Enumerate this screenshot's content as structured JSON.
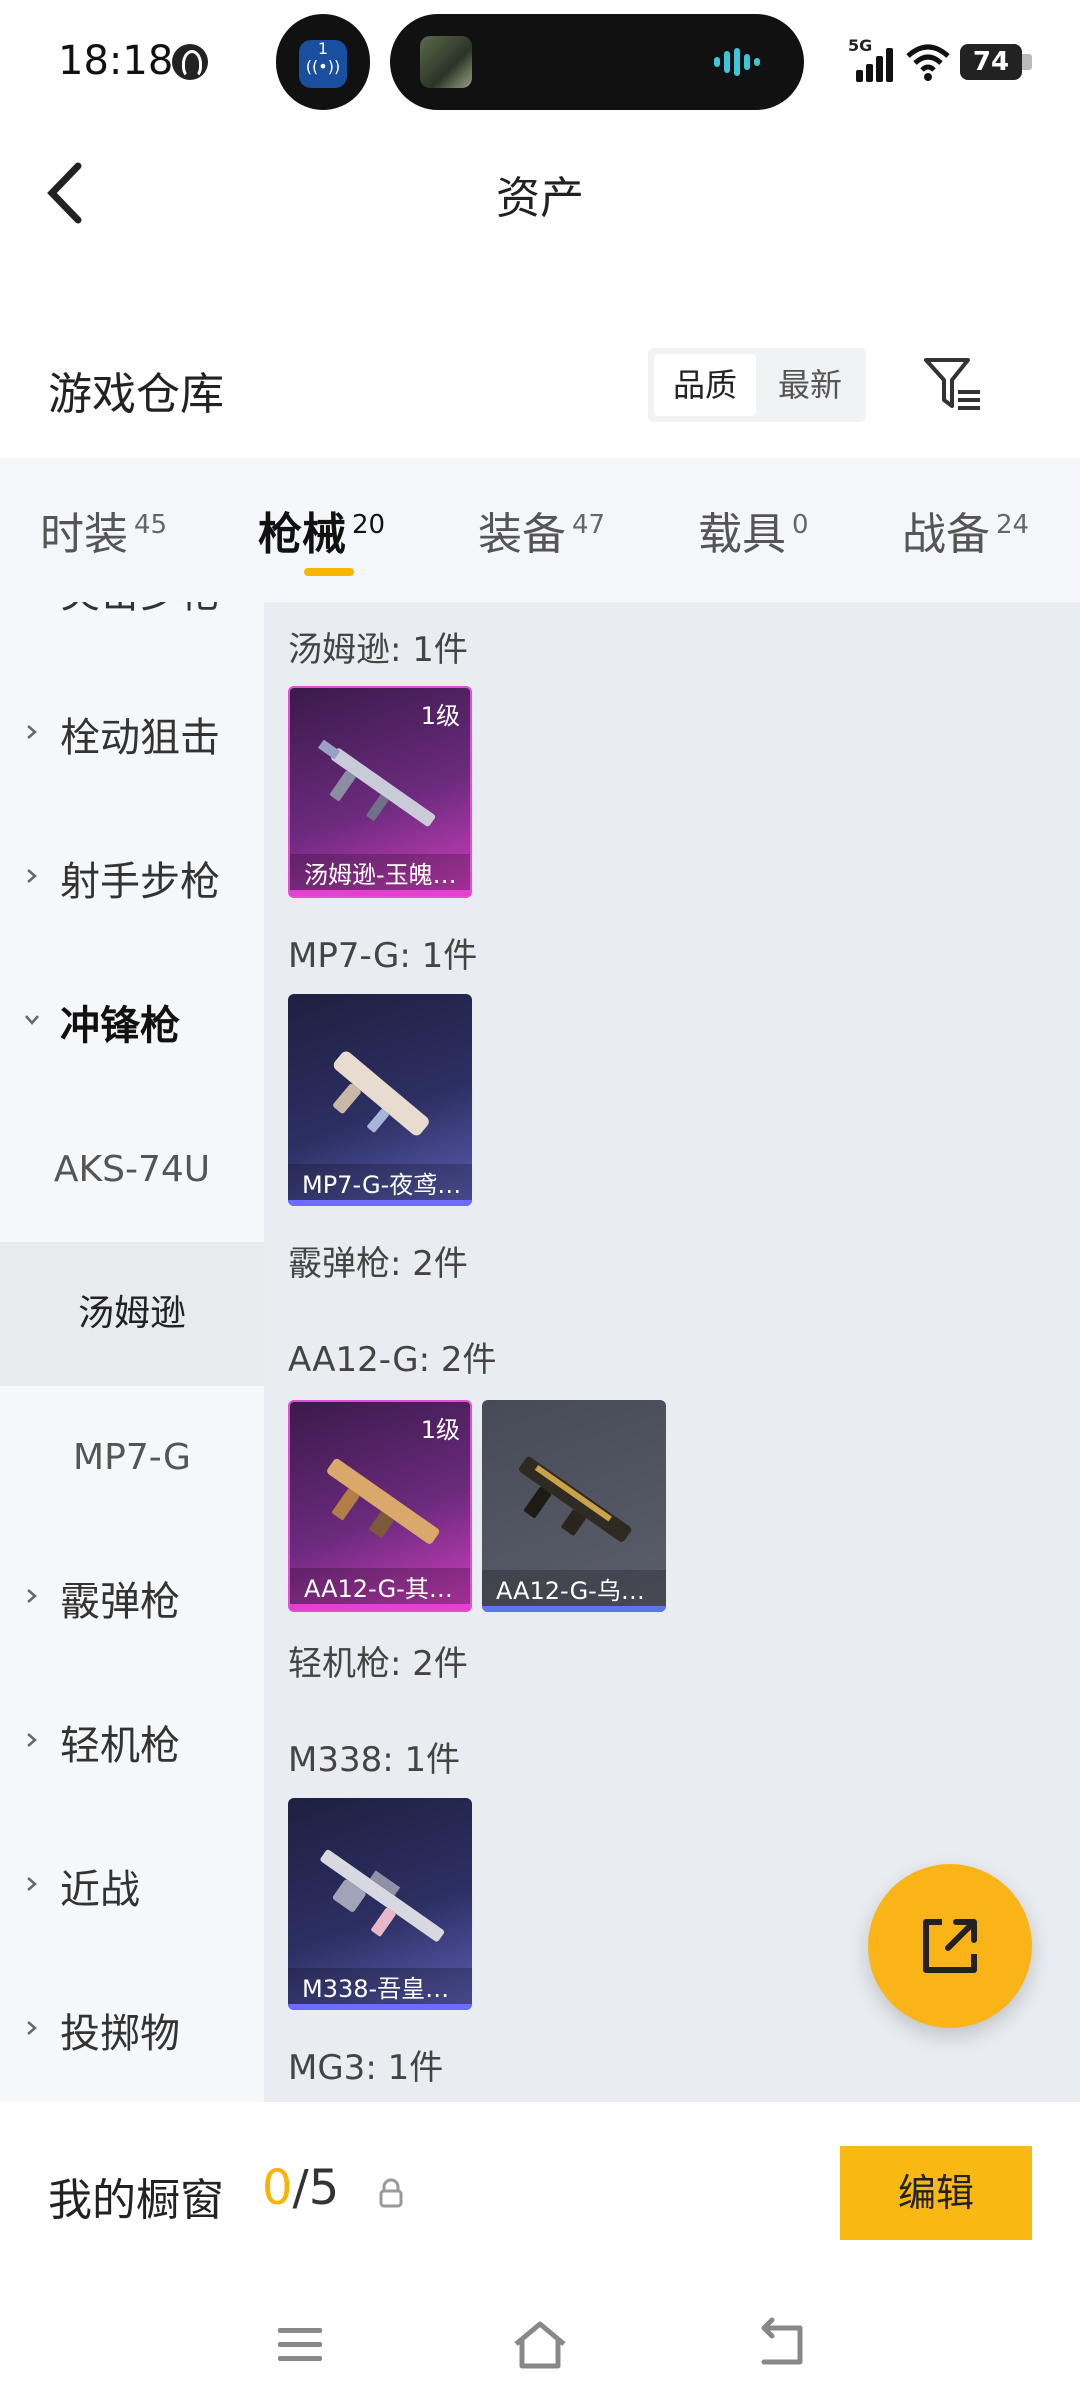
{
  "status_bar": {
    "time": "18:18",
    "network": "5G",
    "battery": "74",
    "notif_count": "1"
  },
  "header": {
    "title": "资产"
  },
  "warehouse": {
    "title": "游戏仓库",
    "sort_options": [
      {
        "label": "品质",
        "active": true
      },
      {
        "label": "最新",
        "active": false
      }
    ]
  },
  "tabs": [
    {
      "label": "时装",
      "count": "45",
      "active": false
    },
    {
      "label": "枪械",
      "count": "20",
      "active": true
    },
    {
      "label": "装备",
      "count": "47",
      "active": false
    },
    {
      "label": "载具",
      "count": "0",
      "active": false
    },
    {
      "label": "战备",
      "count": "24",
      "active": false
    }
  ],
  "sidebar": [
    {
      "label": "突击步枪",
      "type": "category"
    },
    {
      "label": "栓动狙击",
      "type": "category"
    },
    {
      "label": "射手步枪",
      "type": "category"
    },
    {
      "label": "冲锋枪",
      "type": "category-open"
    },
    {
      "label": "AKS-74U",
      "type": "sub"
    },
    {
      "label": "汤姆逊",
      "type": "sub-selected"
    },
    {
      "label": "MP7-G",
      "type": "sub"
    },
    {
      "label": "霰弹枪",
      "type": "category"
    },
    {
      "label": "轻机枪",
      "type": "category"
    },
    {
      "label": "近战",
      "type": "category"
    },
    {
      "label": "投掷物",
      "type": "category"
    }
  ],
  "content": {
    "groups": [
      {
        "label": "汤姆逊: 1件"
      },
      {
        "label": "MP7-G: 1件"
      },
      {
        "label": "霰弹枪: 2件"
      },
      {
        "label": "AA12-G: 2件"
      },
      {
        "label": "轻机枪: 2件"
      },
      {
        "label": "M338: 1件"
      },
      {
        "label": "MG3: 1件"
      }
    ],
    "items": [
      {
        "name": "汤姆逊-玉魄…",
        "level": "1级",
        "rarity": "pink"
      },
      {
        "name": "MP7-G-夜鸢…",
        "level": "",
        "rarity": "purple"
      },
      {
        "name": "AA12-G-其…",
        "level": "1级",
        "rarity": "pink"
      },
      {
        "name": "AA12-G-乌…",
        "level": "",
        "rarity": "grey"
      },
      {
        "name": "M338-吾皇…",
        "level": "",
        "rarity": "purple"
      }
    ]
  },
  "showcase": {
    "title": "我的橱窗",
    "current": "0",
    "total": "/5",
    "edit_label": "编辑"
  },
  "icons": {
    "back": "chevron-left-icon",
    "filter": "filter-list-icon",
    "fab": "share-external-icon",
    "lock": "lock-icon",
    "nav": [
      "menu-icon",
      "home-icon",
      "back-icon"
    ]
  },
  "colors": {
    "accent": "#f7b500",
    "rarity_pink": "#e640d2",
    "rarity_purple": "#6c6cff"
  }
}
